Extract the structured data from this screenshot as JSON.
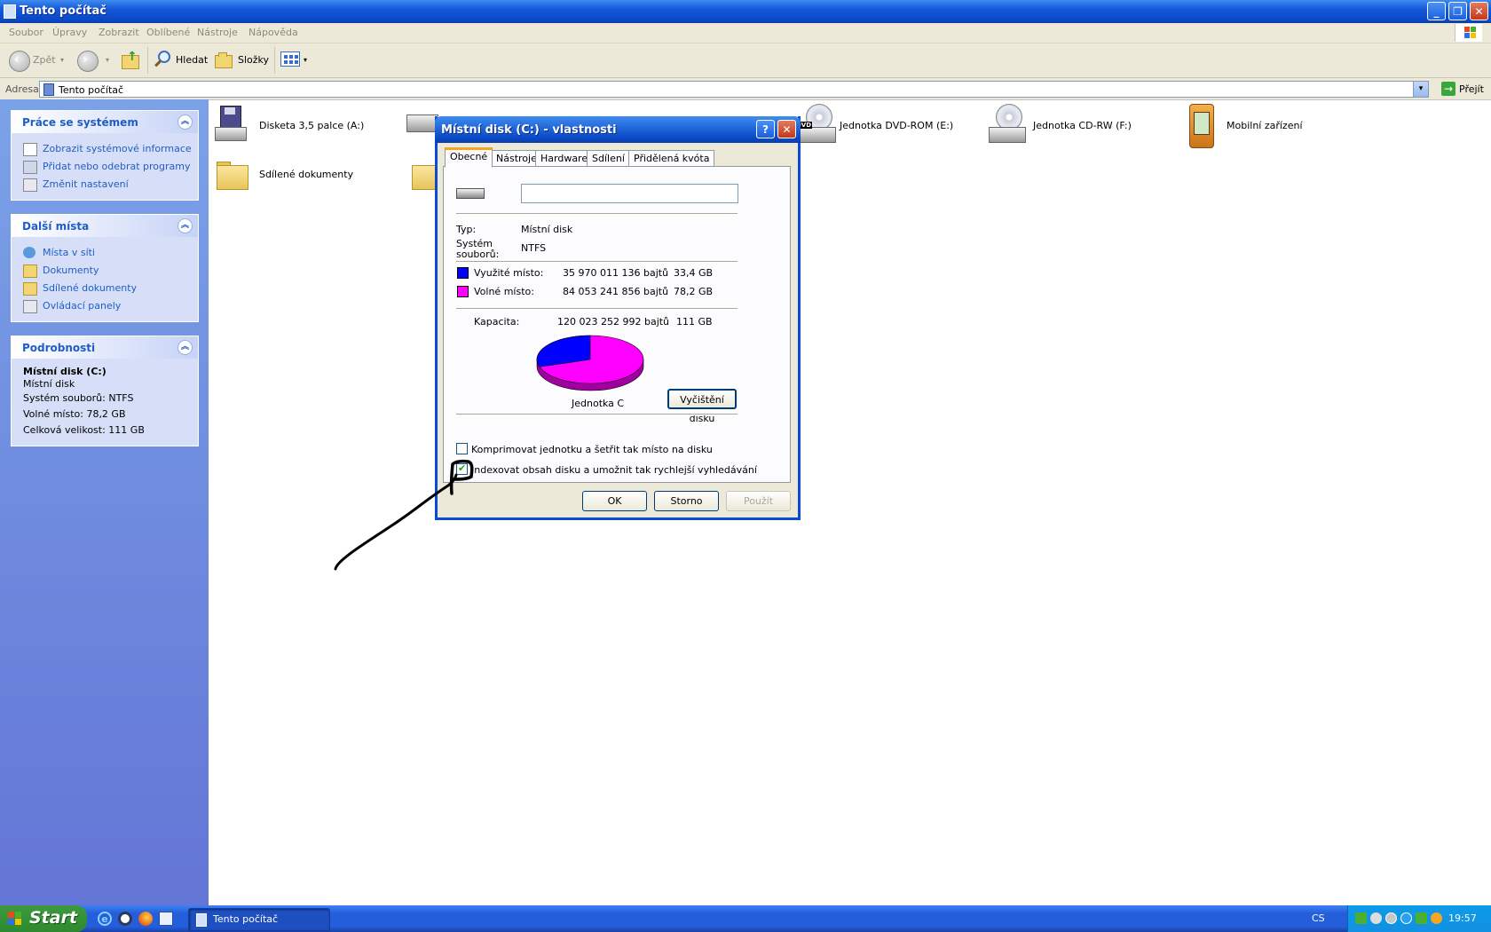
{
  "window": {
    "title": "Tento počítač"
  },
  "menu": [
    "Soubor",
    "Úpravy",
    "Zobrazit",
    "Oblíbené",
    "Nástroje",
    "Nápověda"
  ],
  "toolbar": {
    "back": "Zpět",
    "search": "Hledat",
    "folders": "Složky"
  },
  "address": {
    "label": "Adresa",
    "value": "Tento počítač",
    "go": "Přejít"
  },
  "sidebar": {
    "system": {
      "title": "Práce se systémem",
      "items": [
        "Zobrazit systémové informace",
        "Přidat nebo odebrat programy",
        "Změnit nastavení"
      ]
    },
    "places": {
      "title": "Další místa",
      "items": [
        "Místa v síti",
        "Dokumenty",
        "Sdílené dokumenty",
        "Ovládací panely"
      ]
    },
    "details": {
      "title": "Podrobnosti",
      "name": "Místní disk (C:)",
      "type": "Místní disk",
      "fs": "Systém souborů: NTFS",
      "free": "Volné místo: 78,2 GB",
      "total": "Celková velikost: 111 GB"
    }
  },
  "content": {
    "items": [
      "Disketa 3,5 palce (A:)",
      "Sdílené dokumenty",
      "Jednotka DVD-ROM (E:)",
      "Jednotka CD-RW (F:)",
      "Mobilní zařízení"
    ]
  },
  "dialog": {
    "title": "Místní disk (C:) - vlastnosti",
    "tabs": [
      "Obecné",
      "Nástroje",
      "Hardware",
      "Sdílení",
      "Přidělená kvóta"
    ],
    "name_value": "",
    "type_label": "Typ:",
    "type_value": "Místní disk",
    "fs_label_1": "Systém",
    "fs_label_2": "souborů:",
    "fs_value": "NTFS",
    "used_label": "Využité místo:",
    "used_bytes": "35 970 011 136 bajtů",
    "used_gb": "33,4 GB",
    "free_label": "Volné místo:",
    "free_bytes": "84 053 241 856 bajtů",
    "free_gb": "78,2 GB",
    "cap_label": "Kapacita:",
    "cap_bytes": "120 023 252 992 bajtů",
    "cap_gb": "111 GB",
    "drive_label": "Jednotka C",
    "cleanup": "Vyčištění disku",
    "compress": "Komprimovat jednotku a šetřit tak místo na disku",
    "compress_checked": false,
    "index": "Indexovat obsah disku a umožnit tak rychlejší vyhledávání",
    "index_checked": true,
    "used_fraction": 0.3,
    "colors": {
      "used": "#0000ff",
      "free": "#ff00ff"
    },
    "ok": "OK",
    "cancel": "Storno",
    "apply": "Použít"
  },
  "taskbar": {
    "start": "Start",
    "task": "Tento počítač",
    "lang": "CS",
    "clock": "19:57"
  }
}
